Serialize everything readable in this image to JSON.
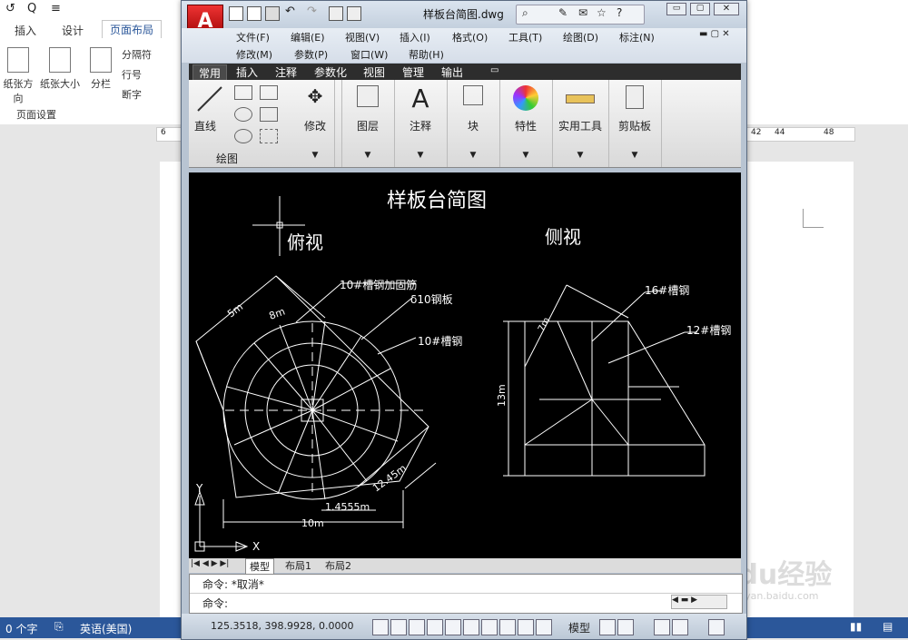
{
  "word": {
    "quick_access": [
      "↺",
      "Q",
      "≡"
    ],
    "tabs": [
      "插入",
      "设计",
      "页面布局"
    ],
    "ribbon_buttons": {
      "orientation": "纸张方向",
      "size": "纸张大小",
      "columns": "分栏",
      "breaks": "分隔符",
      "line_numbers": "行号",
      "hyphenation": "断字"
    },
    "group_label": "页面设置",
    "ruler_numbers": [
      "6",
      "42",
      "44",
      "48"
    ],
    "status": {
      "word_count": "0 个字",
      "language": "英语(美国)"
    }
  },
  "acad": {
    "logo": "A",
    "title": "样板台简图.dwg",
    "menu_row1": [
      "文件(F)",
      "编辑(E)",
      "视图(V)",
      "插入(I)",
      "格式(O)",
      "工具(T)",
      "绘图(D)",
      "标注(N)"
    ],
    "menu_row2": [
      "修改(M)",
      "参数(P)",
      "窗口(W)",
      "帮助(H)"
    ],
    "ribbon_tabs": [
      "常用",
      "插入",
      "注释",
      "参数化",
      "视图",
      "管理",
      "输出"
    ],
    "panels": {
      "line": "直线",
      "draw_group": "绘图",
      "modify": "修改",
      "layers": "图层",
      "annotation": "注释",
      "block": "块",
      "properties": "特性",
      "utilities": "实用工具",
      "clipboard": "剪贴板"
    },
    "drawing": {
      "title": "样板台简图",
      "top_view": "俯视",
      "side_view": "侧视",
      "labels_top": [
        "10#槽钢加固筋",
        "δ10钢板",
        "10#槽钢"
      ],
      "labels_side": [
        "16#槽钢",
        "12#槽钢"
      ],
      "dims_top": [
        "5m",
        "8m",
        "12.45m",
        "1.4555m",
        "10m"
      ],
      "dims_side": [
        "7m",
        "13m"
      ],
      "ucs_x": "X",
      "ucs_y": "Y"
    },
    "layout_tabs": [
      "模型",
      "布局1",
      "布局2"
    ],
    "command_history": "命令: *取消*",
    "command_prompt": "命令:",
    "coordinates": "125.3518, 398.9928, 0.0000",
    "status_model": "模型"
  },
  "watermark": "Baidu经验",
  "watermark_url": "jingyan.baidu.com",
  "colors": {
    "word_accent": "#2b579a",
    "canvas": "#000000",
    "linework": "#ffffff"
  }
}
